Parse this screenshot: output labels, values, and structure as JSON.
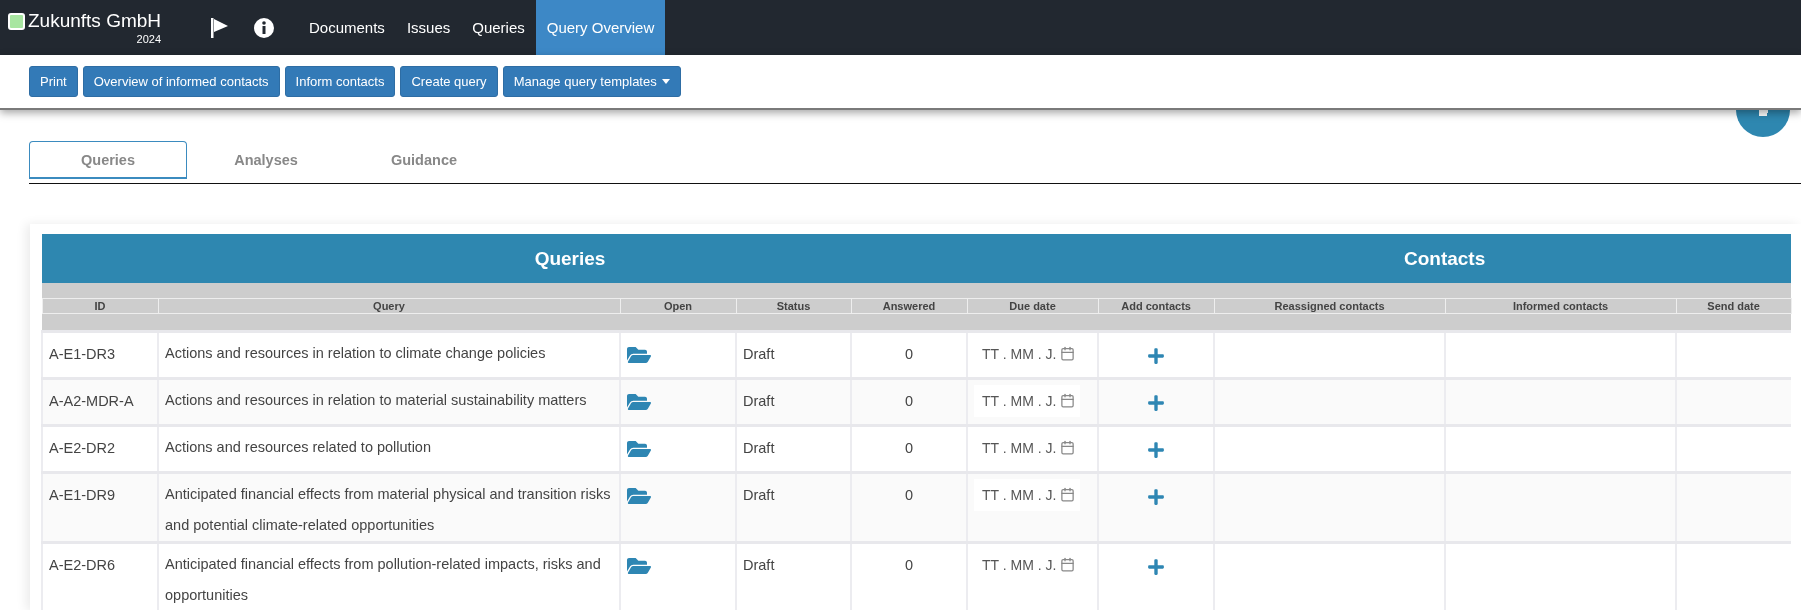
{
  "brand": {
    "name": "Zukunfts GmbH",
    "year": "2024"
  },
  "nav": [
    {
      "label": "Documents",
      "selected": false
    },
    {
      "label": "Issues",
      "selected": false
    },
    {
      "label": "Queries",
      "selected": false
    },
    {
      "label": "Query Overview",
      "selected": true
    }
  ],
  "toolbar": [
    {
      "label": "Print",
      "kind": "button"
    },
    {
      "label": "Overview of informed contacts",
      "kind": "button"
    },
    {
      "label": "Inform contacts",
      "kind": "button"
    },
    {
      "label": "Create query",
      "kind": "button"
    },
    {
      "label": "Manage query templates",
      "kind": "dropdown"
    }
  ],
  "tabs": [
    {
      "label": "Queries",
      "selected": true
    },
    {
      "label": "Analyses",
      "selected": false
    },
    {
      "label": "Guidance",
      "selected": false
    }
  ],
  "table": {
    "groups": [
      {
        "title": "Queries",
        "columns": [
          "ID",
          "Query",
          "Open",
          "Status",
          "Answered",
          "Due date"
        ]
      },
      {
        "title": "Contacts",
        "columns": [
          "Add contacts",
          "Reassigned contacts",
          "Informed contacts",
          "Send date"
        ]
      }
    ],
    "rows": [
      {
        "id": "A-E1-DR3",
        "query": "Actions and resources in relation to climate change policies",
        "status": "Draft",
        "answered": "0",
        "due_date_placeholder": "TT . MM . J."
      },
      {
        "id": "A-A2-MDR-A",
        "query": "Actions and resources in relation to material sustainability matters",
        "status": "Draft",
        "answered": "0",
        "due_date_placeholder": "TT . MM . J."
      },
      {
        "id": "A-E2-DR2",
        "query": "Actions and resources related to pollution",
        "status": "Draft",
        "answered": "0",
        "due_date_placeholder": "TT . MM . J."
      },
      {
        "id": "A-E1-DR9",
        "query": "Anticipated financial effects from material physical and transition risks and potential climate-related opportunities",
        "status": "Draft",
        "answered": "0",
        "due_date_placeholder": "TT . MM . J."
      },
      {
        "id": "A-E2-DR6",
        "query": "Anticipated financial effects from pollution-related impacts, risks and opportunities",
        "status": "Draft",
        "answered": "0",
        "due_date_placeholder": "TT . MM . J."
      }
    ]
  }
}
